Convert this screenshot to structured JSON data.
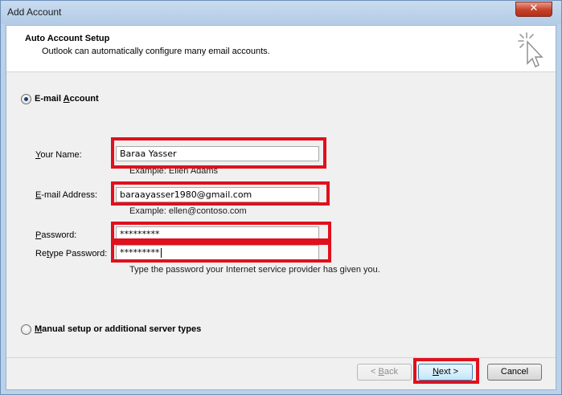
{
  "window": {
    "title": "Add Account",
    "close_glyph": "✕"
  },
  "header": {
    "title": "Auto Account Setup",
    "subtitle": "Outlook can automatically configure many email accounts.",
    "icon": "wizard-cursor-icon"
  },
  "options": {
    "email_account": {
      "label": "E-mail Account",
      "selected": true
    },
    "manual_setup": {
      "label": "Manual setup or additional server types",
      "selected": false
    }
  },
  "form": {
    "your_name": {
      "label": "Your Name:",
      "value": "Baraa Yasser",
      "example": "Example: Ellen Adams"
    },
    "email": {
      "label": "E-mail Address:",
      "value": "baraayasser1980@gmail.com",
      "example": "Example: ellen@contoso.com"
    },
    "password": {
      "label": "Password:",
      "value": "*********"
    },
    "retype_password": {
      "label": "Retype Password:",
      "value": "*********"
    },
    "password_hint": "Type the password your Internet service provider has given you."
  },
  "buttons": {
    "back": "< Back",
    "next": "Next >",
    "cancel": "Cancel"
  },
  "colors": {
    "highlight": "#e0101d",
    "accent": "#1e3f76"
  }
}
